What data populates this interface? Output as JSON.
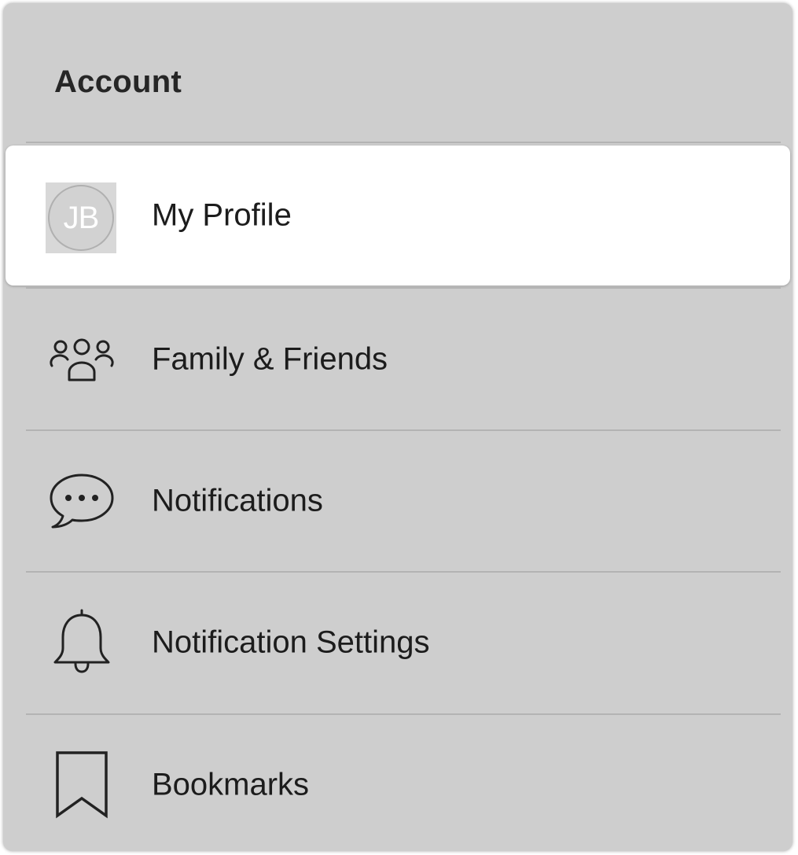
{
  "account": {
    "title": "Account"
  },
  "menu": {
    "profile": {
      "label": "My Profile",
      "initials": "JB",
      "icon": "avatar"
    },
    "family": {
      "label": "Family & Friends",
      "icon": "people-icon"
    },
    "notifications": {
      "label": "Notifications",
      "icon": "chat-bubble-icon"
    },
    "notification_settings": {
      "label": "Notification Settings",
      "icon": "bell-icon"
    },
    "bookmarks": {
      "label": "Bookmarks",
      "icon": "bookmark-icon"
    }
  },
  "colors": {
    "panel_bg": "#cecece",
    "selected_bg": "#ffffff",
    "text": "#1c1c1c",
    "divider": "#b3b3b3"
  }
}
